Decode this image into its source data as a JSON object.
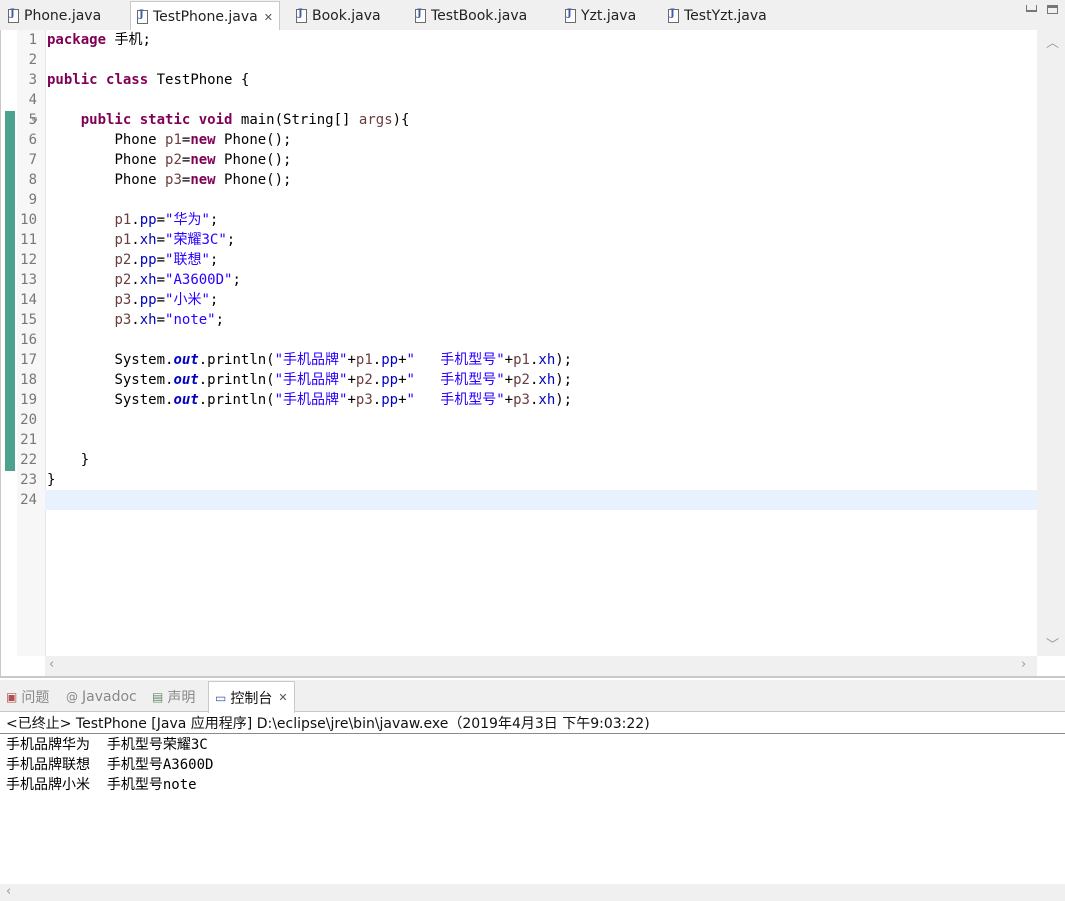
{
  "tabs": [
    {
      "label": "Phone.java",
      "active": false
    },
    {
      "label": "TestPhone.java",
      "active": true
    },
    {
      "label": "Book.java",
      "active": false
    },
    {
      "label": "TestBook.java",
      "active": false
    },
    {
      "label": "Yzt.java",
      "active": false
    },
    {
      "label": "TestYzt.java",
      "active": false
    }
  ],
  "editor": {
    "lines": [
      {
        "n": "1",
        "text": ""
      },
      {
        "n": "2",
        "text": ""
      },
      {
        "n": "3",
        "text": ""
      },
      {
        "n": "4",
        "text": ""
      },
      {
        "n": "5",
        "text": ""
      },
      {
        "n": "6",
        "text": ""
      },
      {
        "n": "7",
        "text": ""
      },
      {
        "n": "8",
        "text": ""
      },
      {
        "n": "9",
        "text": ""
      },
      {
        "n": "10",
        "text": ""
      },
      {
        "n": "11",
        "text": ""
      },
      {
        "n": "12",
        "text": ""
      },
      {
        "n": "13",
        "text": ""
      },
      {
        "n": "14",
        "text": ""
      },
      {
        "n": "15",
        "text": ""
      },
      {
        "n": "16",
        "text": ""
      },
      {
        "n": "17",
        "text": ""
      },
      {
        "n": "18",
        "text": ""
      },
      {
        "n": "19",
        "text": ""
      },
      {
        "n": "20",
        "text": ""
      },
      {
        "n": "21",
        "text": ""
      },
      {
        "n": "22",
        "text": ""
      },
      {
        "n": "23",
        "text": ""
      },
      {
        "n": "24",
        "text": ""
      }
    ],
    "tokens": {
      "kw_package": "package",
      "pkg_name": " 手机;",
      "kw_public": "public",
      "kw_class": "class",
      "class_name": " TestPhone {",
      "kw_static": "static",
      "kw_void": "void",
      "main_sig": " main(String[] ",
      "args": "args",
      "main_close": "){",
      "phone": "Phone ",
      "p1": "p1",
      "p2": "p2",
      "p3": "p3",
      "eq": "=",
      "kw_new": "new",
      "ctor": " Phone();",
      "pp": "pp",
      "xh": "xh",
      "dot": ".",
      "semi": ";",
      "s_huawei": "\"华为\"",
      "s_rongyao": "\"荣耀3C\"",
      "s_lianxiang": "\"联想\"",
      "s_a3600d": "\"A3600D\"",
      "s_xiaomi": "\"小米\"",
      "s_note": "\"note\"",
      "system": "System.",
      "out": "out",
      "println": ".println(",
      "s_pinpai": "\"手机品牌\"",
      "plus": "+",
      "s_xinghao": "\"   手机型号\"",
      "close_call": ");",
      "close_brace_method": "    }",
      "close_brace_class": "}"
    }
  },
  "console": {
    "tabs": [
      {
        "label": "问题",
        "icon": "problems-icon"
      },
      {
        "label": "Javadoc",
        "icon": "at-icon"
      },
      {
        "label": "声明",
        "icon": "declaration-icon"
      },
      {
        "label": "控制台",
        "icon": "console-icon",
        "active": true
      }
    ],
    "status": "<已终止> TestPhone [Java 应用程序] D:\\eclipse\\jre\\bin\\javaw.exe（2019年4月3日 下午9:03:22)",
    "output": [
      "手机品牌华为  手机型号荣耀3C",
      "手机品牌联想  手机型号A3600D",
      "手机品牌小米  手机型号note"
    ]
  },
  "colors": {
    "keyword": "#7f0055",
    "string": "#2a00ff",
    "field": "#0000c0",
    "local_variable": "#6a3e3e",
    "change_bar": "#4aa28f",
    "current_line": "#e8f2fe"
  }
}
